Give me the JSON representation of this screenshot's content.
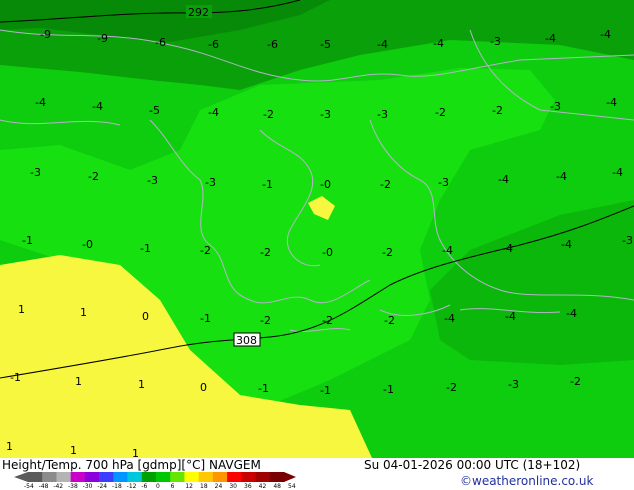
{
  "map": {
    "contour_labels": [
      "292",
      "308"
    ],
    "temperature_labels": [
      "-9",
      "-9",
      "-6",
      "-6",
      "-6",
      "-5",
      "-4",
      "-4",
      "-3",
      "-4",
      "-4",
      "-4",
      "-4",
      "-5",
      "-4",
      "-2",
      "-3",
      "-3",
      "-2",
      "-2",
      "-3",
      "-4",
      "-3",
      "-2",
      "-3",
      "-3",
      "-1",
      "-0",
      "-2",
      "-3",
      "-4",
      "-4",
      "-4",
      "-1",
      "-0",
      "-1",
      "-2",
      "-2",
      "-0",
      "-2",
      "-4",
      "-4",
      "-4",
      "-3",
      "1",
      "1",
      "0",
      "-1",
      "-2",
      "-2",
      "-2",
      "-4",
      "-4",
      "-4",
      "-1",
      "1",
      "1",
      "0",
      "-1",
      "-1",
      "-1",
      "-2",
      "-3",
      "-2",
      "1",
      "1",
      "1"
    ]
  },
  "footer": {
    "left_title": "Height/Temp. 700 hPa [gdmp][°C] NAVGEM",
    "right_title": "Su 04-01-2026 00:00 UTC (18+102)",
    "credit": "©weatheronline.co.uk",
    "scale_labels": [
      "-54",
      "-48",
      "-42",
      "-38",
      "-30",
      "-24",
      "-18",
      "-12",
      "-6",
      "0",
      "6",
      "12",
      "18",
      "24",
      "30",
      "36",
      "42",
      "48",
      "54"
    ],
    "scale_colors": [
      "#5a5a5a",
      "#8c8c8c",
      "#b4b4b4",
      "#c800c8",
      "#8c00dc",
      "#3c3cff",
      "#0096ff",
      "#00c8dc",
      "#00a000",
      "#00c800",
      "#64e600",
      "#ffff00",
      "#ffc800",
      "#ff9600",
      "#ff0000",
      "#c80000",
      "#a00000",
      "#780000"
    ]
  }
}
